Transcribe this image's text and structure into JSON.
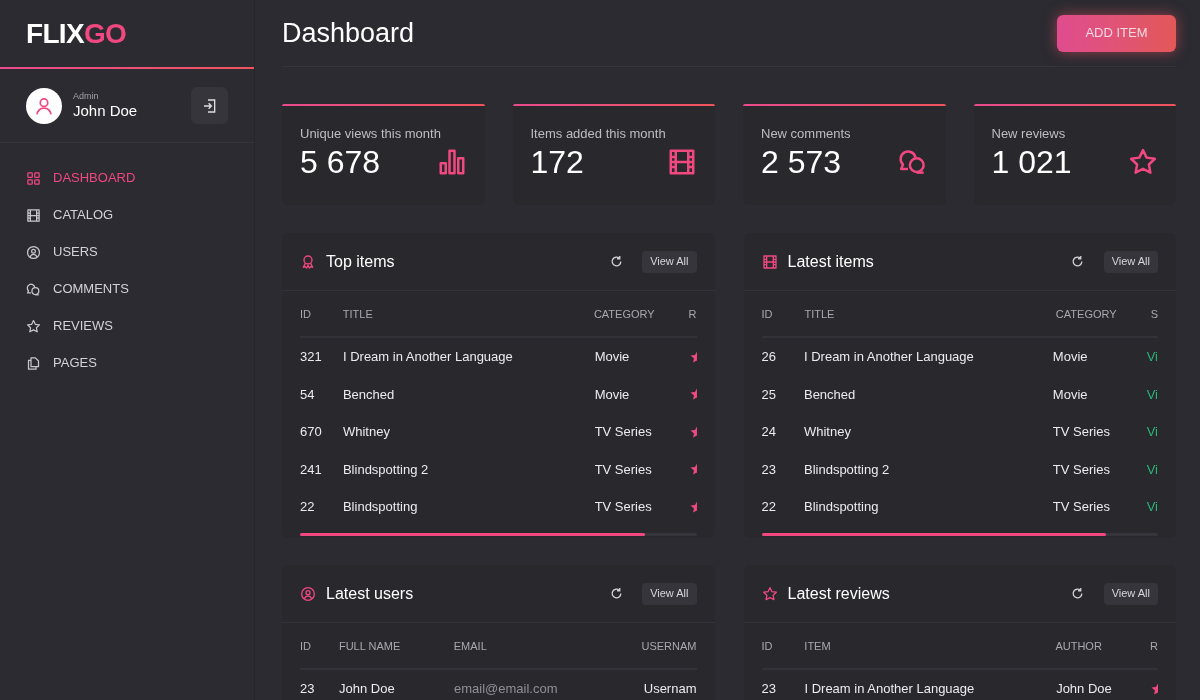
{
  "logo": {
    "part_1": "FLIX",
    "part_2": "GO"
  },
  "profile": {
    "role": "Admin",
    "name": "John Doe"
  },
  "nav": [
    {
      "label": "DASHBOARD",
      "kind": "grid",
      "selected": true
    },
    {
      "label": "CATALOG",
      "kind": "film",
      "selected": false
    },
    {
      "label": "USERS",
      "kind": "user",
      "selected": false
    },
    {
      "label": "COMMENTS",
      "kind": "comments",
      "selected": false
    },
    {
      "label": "REVIEWS",
      "kind": "star",
      "selected": false
    },
    {
      "label": "PAGES",
      "kind": "pages",
      "selected": false
    }
  ],
  "page_title": "Dashboard",
  "add_button": "ADD ITEM",
  "stats": [
    {
      "label": "Unique views this month",
      "value": "5 678",
      "kind": "bars"
    },
    {
      "label": "Items added this month",
      "value": "172",
      "kind": "film"
    },
    {
      "label": "New comments",
      "value": "2 573",
      "kind": "comments"
    },
    {
      "label": "New reviews",
      "value": "1 021",
      "kind": "star"
    }
  ],
  "panels": [
    {
      "title": "Top items",
      "kind": "award",
      "view_all": "View All",
      "columns": [
        {
          "label": "ID",
          "kind": "text"
        },
        {
          "label": "TITLE",
          "kind": "text"
        },
        {
          "label": "CATEGORY",
          "kind": "text"
        },
        {
          "label": "R",
          "kind": "rating"
        }
      ],
      "rows": [
        [
          "321",
          "I Dream in Another Language",
          "Movie"
        ],
        [
          "54",
          "Benched",
          "Movie"
        ],
        [
          "670",
          "Whitney",
          "TV Series"
        ],
        [
          "241",
          "Blindspotting 2",
          "TV Series"
        ],
        [
          "22",
          "Blindspotting",
          "TV Series"
        ]
      ]
    },
    {
      "title": "Latest items",
      "kind": "film",
      "view_all": "View All",
      "columns": [
        {
          "label": "ID",
          "kind": "text"
        },
        {
          "label": "TITLE",
          "kind": "text"
        },
        {
          "label": "CATEGORY",
          "kind": "text"
        },
        {
          "label": "S",
          "kind": "status"
        }
      ],
      "rows": [
        [
          "26",
          "I Dream in Another Language",
          "Movie",
          "Vi"
        ],
        [
          "25",
          "Benched",
          "Movie",
          "Vi"
        ],
        [
          "24",
          "Whitney",
          "TV Series",
          "Vi"
        ],
        [
          "23",
          "Blindspotting 2",
          "TV Series",
          "Vi"
        ],
        [
          "22",
          "Blindspotting",
          "TV Series",
          "Vi"
        ]
      ]
    },
    {
      "title": "Latest users",
      "kind": "user",
      "view_all": "View All",
      "columns": [
        {
          "label": "ID",
          "kind": "text"
        },
        {
          "label": "FULL NAME",
          "kind": "text"
        },
        {
          "label": "EMAIL",
          "kind": "muted"
        },
        {
          "label": "USERNAM",
          "kind": "text"
        }
      ],
      "rows": [
        [
          "23",
          "John Doe",
          "email@email.com",
          "Usernam"
        ]
      ]
    },
    {
      "title": "Latest reviews",
      "kind": "star",
      "view_all": "View All",
      "columns": [
        {
          "label": "ID",
          "kind": "text"
        },
        {
          "label": "ITEM",
          "kind": "text"
        },
        {
          "label": "AUTHOR",
          "kind": "text"
        },
        {
          "label": "R",
          "kind": "rating"
        }
      ],
      "rows": [
        [
          "23",
          "I Dream in Another Language",
          "John Doe"
        ]
      ]
    }
  ]
}
